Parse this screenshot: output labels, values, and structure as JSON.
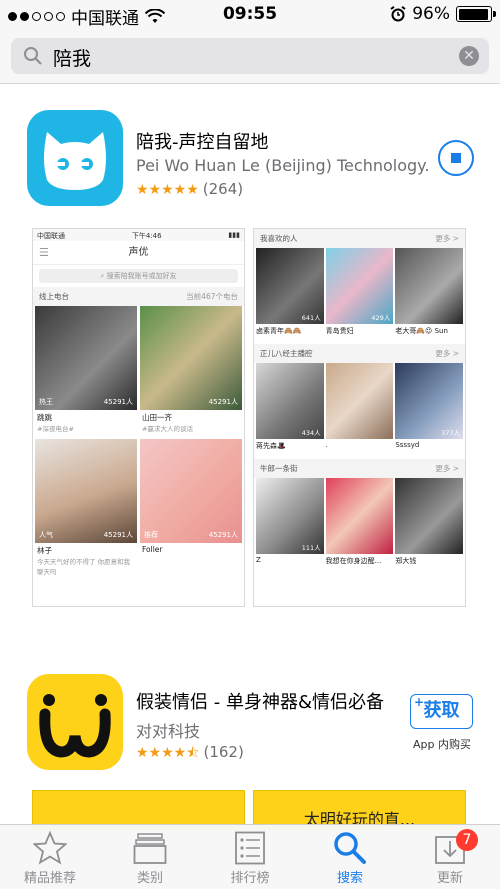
{
  "status_bar": {
    "carrier": "中国联通",
    "time": "09:55",
    "battery": "96%",
    "battery_level": 0.96,
    "signal_dots_filled": 2,
    "signal_dots_total": 5
  },
  "search": {
    "query": "陪我",
    "icon": "search-icon",
    "clear_icon": "clear-icon"
  },
  "result1": {
    "name": "陪我-声控自留地",
    "developer": "Pei Wo Huan Le (Beijing) Technology...",
    "stars": "★★★★★",
    "rating_count": "(264)",
    "rating": 5,
    "action": "stop-download-button"
  },
  "screenshot1": {
    "carrier": "中国联通",
    "time": "下午4:46",
    "title": "声优",
    "search_placeholder": "搜索陪我账号或加好友",
    "section": "线上电台",
    "online_count": "当前467个电台",
    "tiles": [
      {
        "tag": "热王",
        "count": "45291人",
        "name": "跳跳",
        "desc": "#深夜电台#"
      },
      {
        "tag": "",
        "count": "45291人",
        "name": "山田一齐",
        "desc": "#赢求大人的谈话"
      },
      {
        "tag": "人气",
        "count": "45291人",
        "name": "林子",
        "desc": "今天天气好的不得了 你愿意和我聊天吗"
      },
      {
        "tag": "推荐",
        "count": "45291人",
        "name": "Foller",
        "desc": ""
      }
    ]
  },
  "screenshot2": {
    "sections": [
      {
        "title": "我喜欢的人",
        "more": "更多 >",
        "names": [
          "卤素青年🙈🙈",
          "青岛贵妇",
          "老大哥🙈😉 Sun"
        ],
        "counts": [
          "641人",
          "429人",
          ""
        ]
      },
      {
        "title": "正儿八经主播腔",
        "more": "更多 >",
        "names": [
          "蒋先森🎩",
          ".",
          "Ssssyd"
        ],
        "counts": [
          "434人",
          "",
          "377人"
        ]
      },
      {
        "title": "牛郎一条街",
        "more": "更多 >",
        "names": [
          "Z",
          "我想在你身边醒...",
          "郑大钱"
        ],
        "counts": [
          "111人",
          "",
          ""
        ]
      }
    ]
  },
  "result2": {
    "name": "假装情侣 - 单身神器&情侣必备",
    "developer": "对对科技",
    "stars": "★★★★⯪",
    "rating_count": "(162)",
    "rating": 4.5,
    "get_label": "获取",
    "plus": "+",
    "iap_label": "App 内购买"
  },
  "result2_previews": [
    "",
    "太明好玩的直..."
  ],
  "tabbar": {
    "tabs": [
      {
        "label": "精品推荐",
        "icon": "star-icon"
      },
      {
        "label": "类别",
        "icon": "stack-icon"
      },
      {
        "label": "排行榜",
        "icon": "list-icon"
      },
      {
        "label": "搜索",
        "icon": "search-icon"
      },
      {
        "label": "更新",
        "icon": "download-icon"
      }
    ],
    "active": "搜索",
    "update_badge": "7"
  },
  "colors": {
    "accent": "#1a7ee8",
    "star": "#f39c12",
    "icon1_bg": "#1fb6e6",
    "icon2_bg": "#ffd21a",
    "badge": "#ff3b30"
  }
}
